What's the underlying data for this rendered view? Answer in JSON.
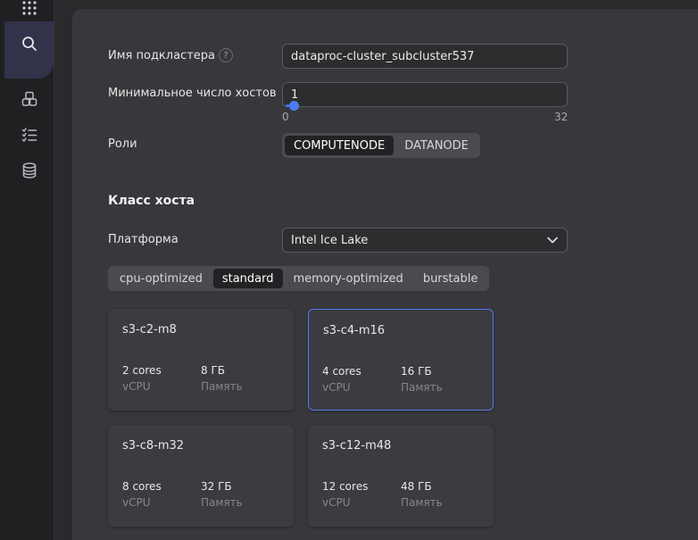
{
  "nav": {
    "icons": [
      "apps-grid-icon",
      "search-icon",
      "components-icon",
      "tasks-list-icon",
      "database-icon"
    ]
  },
  "form": {
    "subcluster_name_label": "Имя подкластера",
    "help_mark": "?",
    "subcluster_name_value": "dataproc-cluster_subcluster537",
    "min_hosts_label": "Минимальное число хостов",
    "min_hosts_value": "1",
    "min_hosts_slider": {
      "min": "0",
      "max": "32",
      "value": 1
    },
    "roles_label": "Роли",
    "roles": [
      {
        "label": "COMPUTENODE",
        "active": true
      },
      {
        "label": "DATANODE",
        "active": false
      }
    ]
  },
  "host_class": {
    "title": "Класс хоста",
    "platform_label": "Платформа",
    "platform_value": "Intel Ice Lake",
    "categories": [
      {
        "label": "cpu-optimized",
        "active": false
      },
      {
        "label": "standard",
        "active": true
      },
      {
        "label": "memory-optimized",
        "active": false
      },
      {
        "label": "burstable",
        "active": false
      }
    ],
    "presets": [
      {
        "name": "s3-c2-m8",
        "cores": "2 cores",
        "cores_unit": "vCPU",
        "memory": "8 ГБ",
        "memory_unit": "Память",
        "selected": false
      },
      {
        "name": "s3-c4-m16",
        "cores": "4 cores",
        "cores_unit": "vCPU",
        "memory": "16 ГБ",
        "memory_unit": "Память",
        "selected": true
      },
      {
        "name": "s3-c8-m32",
        "cores": "8 cores",
        "cores_unit": "vCPU",
        "memory": "32 ГБ",
        "memory_unit": "Память",
        "selected": false
      },
      {
        "name": "s3-c12-m48",
        "cores": "12 cores",
        "cores_unit": "vCPU",
        "memory": "48 ГБ",
        "memory_unit": "Память",
        "selected": false
      }
    ]
  },
  "colors": {
    "accent": "#4f7cf0",
    "panel": "#38383c",
    "background": "#2a2a2d"
  }
}
